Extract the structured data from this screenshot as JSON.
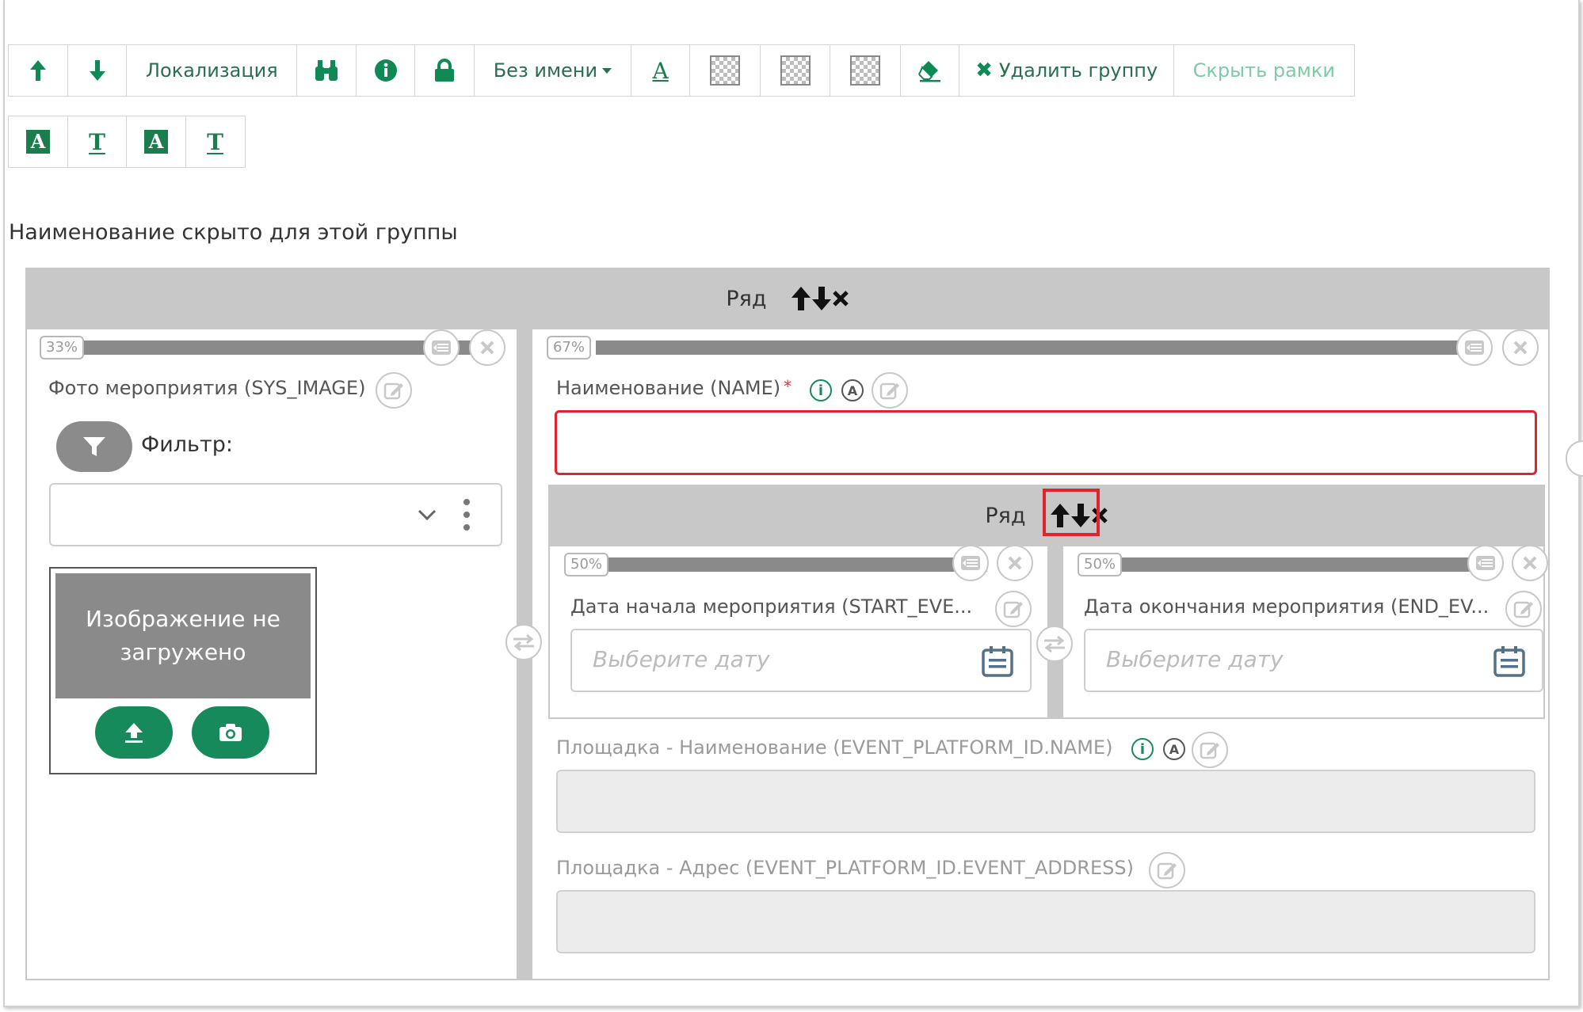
{
  "toolbar_row1": {
    "localization_label": "Локализация",
    "name_dropdown_label": "Без имени",
    "delete_group_label": "Удалить группу",
    "hide_frames_label": "Скрыть рамки",
    "font_letter_a": "A",
    "delete_icon": "✖"
  },
  "toolbar_row2": {
    "glyph_a": "A",
    "glyph_t": "T"
  },
  "group_caption": "Наименование скрыто для этой группы",
  "outer_row": {
    "label": "Ряд",
    "left_col": {
      "percent": "33%",
      "field_label": "Фото мероприятия (SYS_IMAGE)",
      "filter_label": "Фильтр:",
      "image_placeholder": "Изображение не загружено"
    },
    "right_col": {
      "percent": "67%",
      "name_field_label": "Наименование (NAME)",
      "required_mark": "*",
      "info_glyph": "i",
      "auto_glyph": "A",
      "inner_row": {
        "label": "Ряд",
        "left": {
          "percent": "50%",
          "field_label": "Дата начала мероприятия (START_EVE...",
          "placeholder": "Выберите дату"
        },
        "right": {
          "percent": "50%",
          "field_label": "Дата окончания мероприятия (END_EV...",
          "placeholder": "Выберите дату"
        }
      },
      "platform_name_label": "Площадка - Наименование (EVENT_PLATFORM_ID.NAME)",
      "platform_address_label": "Площадка - Адрес (EVENT_PLATFORM_ID.EVENT_ADDRESS)"
    }
  },
  "colors": {
    "accent_green": "#168a5a",
    "error_red": "#e0232e",
    "row_gray": "#c8c8c8"
  },
  "icons": {
    "up": "arrow-up-icon",
    "down": "arrow-down-icon",
    "binoculars": "binoculars-icon",
    "info": "info-icon",
    "lock": "lock-icon",
    "eraser": "eraser-icon",
    "calendar": "calendar-icon",
    "upload": "upload-icon",
    "camera": "camera-icon",
    "filter": "filter-icon",
    "edit": "edit-icon",
    "close": "close-icon",
    "swap": "swap-icon"
  }
}
